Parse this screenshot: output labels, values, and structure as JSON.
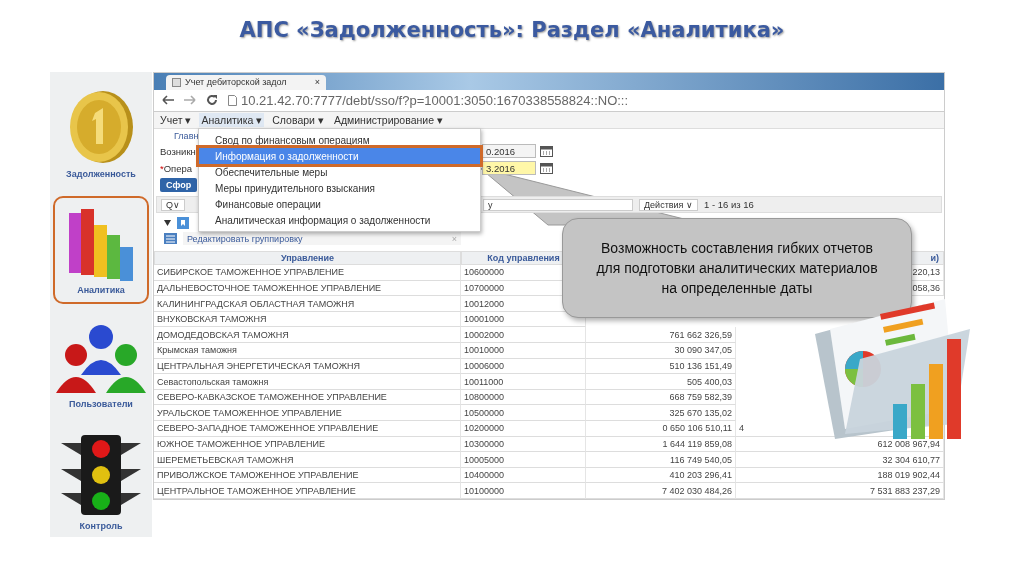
{
  "slide_title": "АПС «Задолженность»: Раздел «Аналитика»",
  "sidebar": {
    "items": [
      {
        "label": "Задолженность",
        "kind": "coin",
        "selected": false
      },
      {
        "label": "Аналитика",
        "kind": "chart",
        "selected": true
      },
      {
        "label": "Пользователи",
        "kind": "users",
        "selected": false
      },
      {
        "label": "Контроль",
        "kind": "traffic",
        "selected": false
      }
    ]
  },
  "browser": {
    "tab": {
      "title": "Учет дебиторской задол",
      "close": "×"
    },
    "address": "10.21.42.70:7777/debt/sso/f?p=10001:3050:1670338558824::NO:::"
  },
  "menu_bar": [
    {
      "label": "Учет",
      "arrow": "▾",
      "open": false
    },
    {
      "label": "Аналитика",
      "arrow": "▾",
      "open": true
    },
    {
      "label": "Словари",
      "arrow": "▾",
      "open": false
    },
    {
      "label": "Администрирование",
      "arrow": "▾",
      "open": false
    }
  ],
  "dropdown": [
    {
      "label": "Свод по финансовым операциям",
      "selected": false
    },
    {
      "label": "Информация о задолженности",
      "selected": true
    },
    {
      "label": "Обеспечительные меры",
      "selected": false
    },
    {
      "label": "Меры принудительного взыскания",
      "selected": false
    },
    {
      "label": "Финансовые операции",
      "selected": false
    },
    {
      "label": "Аналитическая информация о задолженности",
      "selected": false
    }
  ],
  "breadcrumb": "Главн",
  "form": [
    {
      "label": "Возникн",
      "required": false,
      "value": "0.2016"
    },
    {
      "label": "Опера",
      "mark": "*",
      "required": true,
      "value": "3.2016"
    }
  ],
  "form_button": "Сфор",
  "toolbar": {
    "search": "Q∨",
    "select": "у",
    "actions": "Действия ∨",
    "pager": "1 - 16 из 16"
  },
  "grouping": {
    "label": "Редактировать группировку",
    "close": "×"
  },
  "table": {
    "columns": [
      "Управление",
      "Код управления",
      "",
      "и)"
    ],
    "rows": [
      {
        "name": "СИБИРСКОЕ ТАМОЖЕННОЕ УПРАВЛЕНИЕ",
        "code": "10600000",
        "column_4": "220,13"
      },
      {
        "name": "ДАЛЬНЕВОСТОЧНОЕ ТАМОЖЕННОЕ УПРАВЛЕНИЕ",
        "code": "10700000",
        "column_4": "058,36"
      },
      {
        "name": "КАЛИНИНГРАДСКАЯ ОБЛАСТНАЯ ТАМОЖНЯ",
        "code": "10012000"
      },
      {
        "name": "ВНУКОВСКАЯ ТАМОЖНЯ",
        "code": "10001000"
      },
      {
        "name": "ДОМОДЕДОВСКАЯ ТАМОЖНЯ",
        "code": "10002000",
        "column_3": "761 662 326,59"
      },
      {
        "name": "Крымская таможня",
        "code": "10010000",
        "column_3": "30 090 347,05"
      },
      {
        "name": "ЦЕНТРАЛЬНАЯ ЭНЕРГЕТИЧЕСКАЯ ТАМОЖНЯ",
        "code": "10006000",
        "column_3": "510 136 151,49"
      },
      {
        "name": "Севастопольская таможня",
        "code": "10011000",
        "column_3": "505 400,03"
      },
      {
        "name": "СЕВЕРО-КАВКАЗСКОЕ ТАМОЖЕННОЕ УПРАВЛЕНИЕ",
        "code": "10800000",
        "column_3": "668 759 582,39"
      },
      {
        "name": "УРАЛЬСКОЕ ТАМОЖЕННОЕ УПРАВЛЕНИЕ",
        "code": "10500000",
        "column_3": "325 670 135,02"
      },
      {
        "name": "СЕВЕРО-ЗАПАДНОЕ ТАМОЖЕННОЕ УПРАВЛЕНИЕ",
        "code": "10200000",
        "column_3": "0 650 106 510,11",
        "column_4": "4"
      },
      {
        "name": "ЮЖНОЕ ТАМОЖЕННОЕ УПРАВЛЕНИЕ",
        "code": "10300000",
        "column_3": "1 644 119 859,08",
        "column_4": "612 008 967,94"
      },
      {
        "name": "ШЕРЕМЕТЬЕВСКАЯ ТАМОЖНЯ",
        "code": "10005000",
        "column_3": "116 749 540,05",
        "column_4": "32 304 610,77"
      },
      {
        "name": "ПРИВОЛЖСКОЕ ТАМОЖЕННОЕ УПРАВЛЕНИЕ",
        "code": "10400000",
        "column_3": "410 203 296,41",
        "column_4": "188 019 902,44"
      },
      {
        "name": "ЦЕНТРАЛЬНОЕ ТАМОЖЕННОЕ УПРАВЛЕНИЕ",
        "code": "10100000",
        "column_3": "7 402 030 484,26",
        "column_4": "7 531 883 237,29"
      }
    ]
  },
  "callout": "Возможность составления гибких отчетов для подготовки аналитических материалов на определенные даты"
}
